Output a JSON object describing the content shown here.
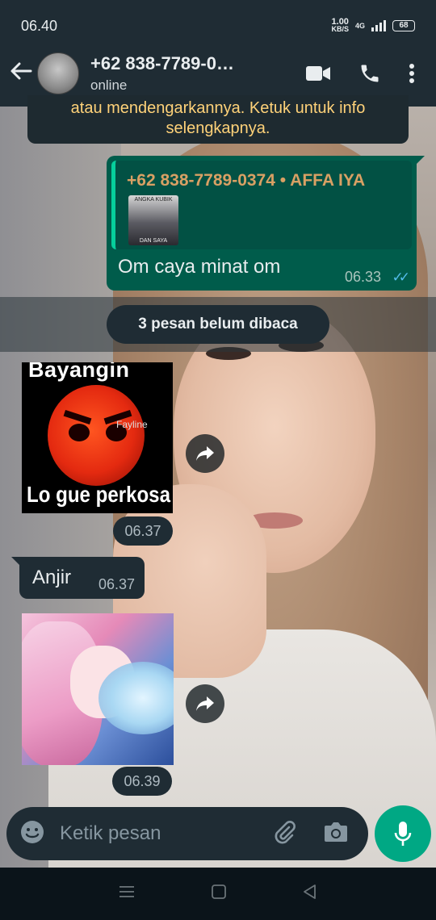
{
  "status_bar": {
    "time": "06.40",
    "net_speed_value": "1.00",
    "net_speed_unit": "KB/S",
    "network": "4G",
    "battery": "68"
  },
  "header": {
    "contact_name": "+62 838-7789-0…",
    "contact_status": "online",
    "icons": [
      "back-arrow-icon",
      "video-call-icon",
      "voice-call-icon",
      "more-options-icon"
    ]
  },
  "system_note": {
    "line1": "atau mendengarkannya. Ketuk untuk info",
    "line2": "selengkapnya."
  },
  "outgoing_message": {
    "quote_name": "+62 838-7789-0374 • AFFA IYA",
    "quote_thumb_top": "ANGKA KUBIK",
    "quote_thumb_bottom": "DAN SAYA",
    "text": "Om caya minat om",
    "time": "06.33",
    "ticks": "✓✓"
  },
  "unread_banner": "3 pesan belum dibaca",
  "sticker1": {
    "top_text": "Bayangin",
    "bottom_text": "Lo gue perkosa",
    "watermark": "Fayline",
    "time": "06.37"
  },
  "incoming_message": {
    "text": "Anjir",
    "time": "06.37"
  },
  "sticker2": {
    "time": "06.39"
  },
  "composer": {
    "placeholder": "Ketik pesan"
  },
  "colors": {
    "header_bg": "#1f2c34",
    "outgoing_bubble": "#005c4b",
    "accent_green": "#00a884",
    "quote_name": "#d9a064",
    "read_ticks": "#53bdeb"
  }
}
